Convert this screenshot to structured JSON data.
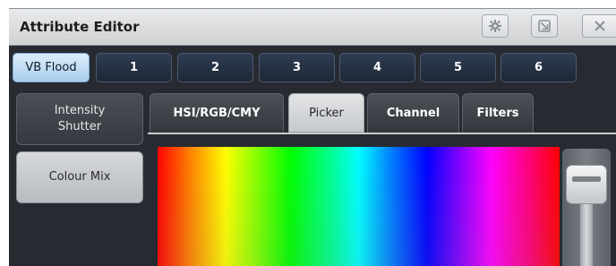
{
  "window": {
    "title": "Attribute Editor"
  },
  "titlebar_buttons": [
    {
      "name": "settings-button",
      "icon": "gear-icon"
    },
    {
      "name": "undock-button",
      "icon": "undock-icon"
    },
    {
      "name": "close-button",
      "icon": "close-icon"
    }
  ],
  "fixture_tabs": [
    "VB Flood",
    "1",
    "2",
    "3",
    "4",
    "5",
    "6"
  ],
  "active_fixture_tab": "VB Flood",
  "left_buttons": [
    {
      "label_line1": "Intensity",
      "label_line2": "Shutter"
    },
    {
      "label_line1": "Colour Mix",
      "label_line2": ""
    }
  ],
  "sub_tabs": [
    "HSI/RGB/CMY",
    "Picker",
    "Channel",
    "Filters"
  ],
  "active_sub_tab": "Picker",
  "colors": {
    "active_tab": "#a9cdee",
    "fixture_tab": "#1d2635",
    "background": "#272b31"
  }
}
